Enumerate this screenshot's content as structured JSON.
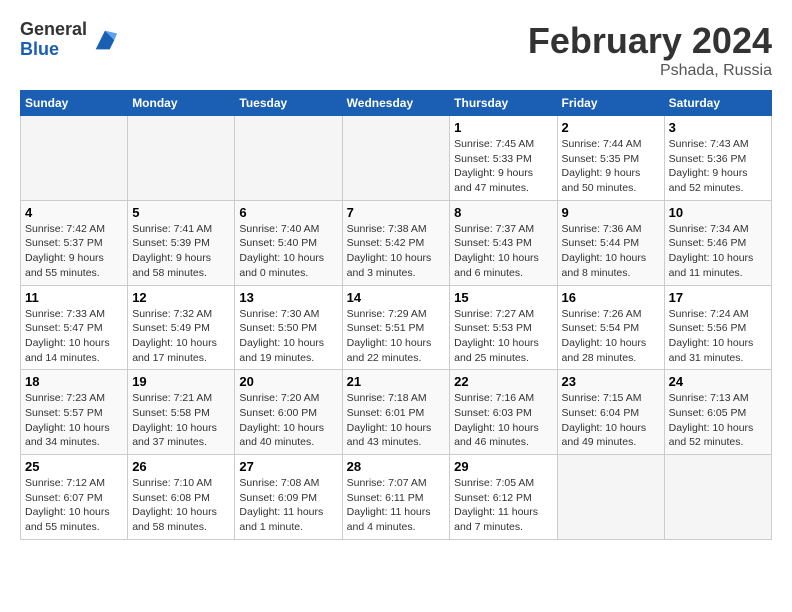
{
  "logo": {
    "general": "General",
    "blue": "Blue"
  },
  "title": "February 2024",
  "subtitle": "Pshada, Russia",
  "weekdays": [
    "Sunday",
    "Monday",
    "Tuesday",
    "Wednesday",
    "Thursday",
    "Friday",
    "Saturday"
  ],
  "weeks": [
    [
      {
        "day": "",
        "info": ""
      },
      {
        "day": "",
        "info": ""
      },
      {
        "day": "",
        "info": ""
      },
      {
        "day": "",
        "info": ""
      },
      {
        "day": "1",
        "info": "Sunrise: 7:45 AM\nSunset: 5:33 PM\nDaylight: 9 hours and 47 minutes."
      },
      {
        "day": "2",
        "info": "Sunrise: 7:44 AM\nSunset: 5:35 PM\nDaylight: 9 hours and 50 minutes."
      },
      {
        "day": "3",
        "info": "Sunrise: 7:43 AM\nSunset: 5:36 PM\nDaylight: 9 hours and 52 minutes."
      }
    ],
    [
      {
        "day": "4",
        "info": "Sunrise: 7:42 AM\nSunset: 5:37 PM\nDaylight: 9 hours and 55 minutes."
      },
      {
        "day": "5",
        "info": "Sunrise: 7:41 AM\nSunset: 5:39 PM\nDaylight: 9 hours and 58 minutes."
      },
      {
        "day": "6",
        "info": "Sunrise: 7:40 AM\nSunset: 5:40 PM\nDaylight: 10 hours and 0 minutes."
      },
      {
        "day": "7",
        "info": "Sunrise: 7:38 AM\nSunset: 5:42 PM\nDaylight: 10 hours and 3 minutes."
      },
      {
        "day": "8",
        "info": "Sunrise: 7:37 AM\nSunset: 5:43 PM\nDaylight: 10 hours and 6 minutes."
      },
      {
        "day": "9",
        "info": "Sunrise: 7:36 AM\nSunset: 5:44 PM\nDaylight: 10 hours and 8 minutes."
      },
      {
        "day": "10",
        "info": "Sunrise: 7:34 AM\nSunset: 5:46 PM\nDaylight: 10 hours and 11 minutes."
      }
    ],
    [
      {
        "day": "11",
        "info": "Sunrise: 7:33 AM\nSunset: 5:47 PM\nDaylight: 10 hours and 14 minutes."
      },
      {
        "day": "12",
        "info": "Sunrise: 7:32 AM\nSunset: 5:49 PM\nDaylight: 10 hours and 17 minutes."
      },
      {
        "day": "13",
        "info": "Sunrise: 7:30 AM\nSunset: 5:50 PM\nDaylight: 10 hours and 19 minutes."
      },
      {
        "day": "14",
        "info": "Sunrise: 7:29 AM\nSunset: 5:51 PM\nDaylight: 10 hours and 22 minutes."
      },
      {
        "day": "15",
        "info": "Sunrise: 7:27 AM\nSunset: 5:53 PM\nDaylight: 10 hours and 25 minutes."
      },
      {
        "day": "16",
        "info": "Sunrise: 7:26 AM\nSunset: 5:54 PM\nDaylight: 10 hours and 28 minutes."
      },
      {
        "day": "17",
        "info": "Sunrise: 7:24 AM\nSunset: 5:56 PM\nDaylight: 10 hours and 31 minutes."
      }
    ],
    [
      {
        "day": "18",
        "info": "Sunrise: 7:23 AM\nSunset: 5:57 PM\nDaylight: 10 hours and 34 minutes."
      },
      {
        "day": "19",
        "info": "Sunrise: 7:21 AM\nSunset: 5:58 PM\nDaylight: 10 hours and 37 minutes."
      },
      {
        "day": "20",
        "info": "Sunrise: 7:20 AM\nSunset: 6:00 PM\nDaylight: 10 hours and 40 minutes."
      },
      {
        "day": "21",
        "info": "Sunrise: 7:18 AM\nSunset: 6:01 PM\nDaylight: 10 hours and 43 minutes."
      },
      {
        "day": "22",
        "info": "Sunrise: 7:16 AM\nSunset: 6:03 PM\nDaylight: 10 hours and 46 minutes."
      },
      {
        "day": "23",
        "info": "Sunrise: 7:15 AM\nSunset: 6:04 PM\nDaylight: 10 hours and 49 minutes."
      },
      {
        "day": "24",
        "info": "Sunrise: 7:13 AM\nSunset: 6:05 PM\nDaylight: 10 hours and 52 minutes."
      }
    ],
    [
      {
        "day": "25",
        "info": "Sunrise: 7:12 AM\nSunset: 6:07 PM\nDaylight: 10 hours and 55 minutes."
      },
      {
        "day": "26",
        "info": "Sunrise: 7:10 AM\nSunset: 6:08 PM\nDaylight: 10 hours and 58 minutes."
      },
      {
        "day": "27",
        "info": "Sunrise: 7:08 AM\nSunset: 6:09 PM\nDaylight: 11 hours and 1 minute."
      },
      {
        "day": "28",
        "info": "Sunrise: 7:07 AM\nSunset: 6:11 PM\nDaylight: 11 hours and 4 minutes."
      },
      {
        "day": "29",
        "info": "Sunrise: 7:05 AM\nSunset: 6:12 PM\nDaylight: 11 hours and 7 minutes."
      },
      {
        "day": "",
        "info": ""
      },
      {
        "day": "",
        "info": ""
      }
    ]
  ]
}
